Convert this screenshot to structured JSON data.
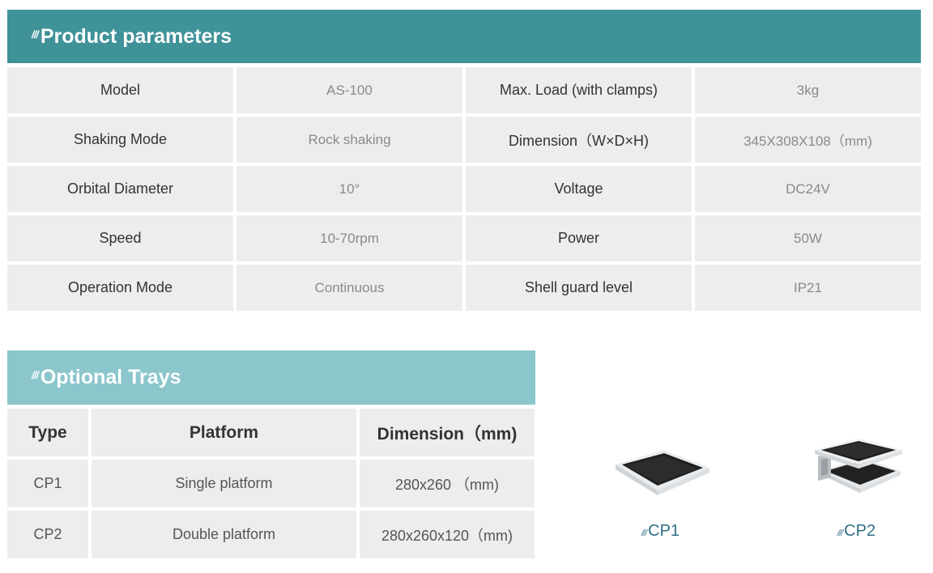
{
  "params": {
    "title": "Product parameters",
    "rows": [
      {
        "label1": "Model",
        "value1": "AS-100",
        "label2": "Max. Load (with clamps)",
        "value2": "3kg"
      },
      {
        "label1": "Shaking Mode",
        "value1": "Rock shaking",
        "label2": "Dimension（W×D×H)",
        "value2": "345X308X108（mm)"
      },
      {
        "label1": "Orbital Diameter",
        "value1": "10°",
        "label2": "Voltage",
        "value2": "DC24V"
      },
      {
        "label1": "Speed",
        "value1": "10-70rpm",
        "label2": "Power",
        "value2": "50W"
      },
      {
        "label1": "Operation Mode",
        "value1": "Continuous",
        "label2": "Shell guard level",
        "value2": "IP21"
      }
    ]
  },
  "trays": {
    "title": "Optional Trays",
    "headers": [
      "Type",
      "Platform",
      "Dimension（mm)"
    ],
    "rows": [
      [
        "CP1",
        "Single platform",
        "280x260 （mm)"
      ],
      [
        "CP2",
        "Double platform",
        "280x260x120（mm)"
      ]
    ],
    "figures": [
      {
        "caption": "CP1"
      },
      {
        "caption": "CP2"
      }
    ]
  }
}
